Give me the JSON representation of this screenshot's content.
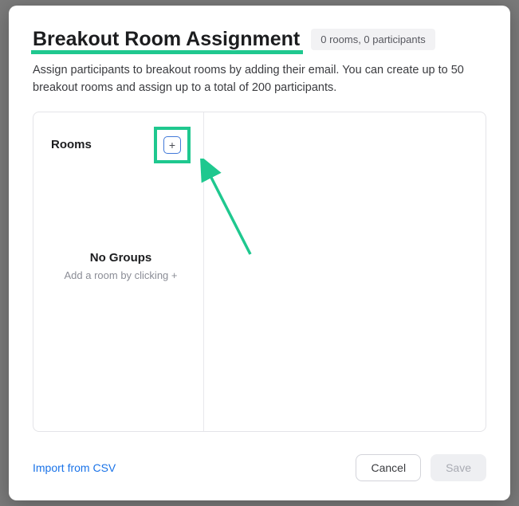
{
  "header": {
    "title": "Breakout Room Assignment",
    "badge": "0 rooms, 0 participants"
  },
  "description": "Assign participants to breakout rooms by adding their email. You can create up to 50 breakout rooms and assign up to a total of 200 participants.",
  "rooms": {
    "label": "Rooms",
    "add_symbol": "+",
    "empty_title": "No Groups",
    "empty_sub": "Add a room by clicking +"
  },
  "footer": {
    "import_label": "Import from CSV",
    "cancel_label": "Cancel",
    "save_label": "Save"
  },
  "colors": {
    "accent_green": "#1fc88f",
    "link_blue": "#1a73e8"
  }
}
